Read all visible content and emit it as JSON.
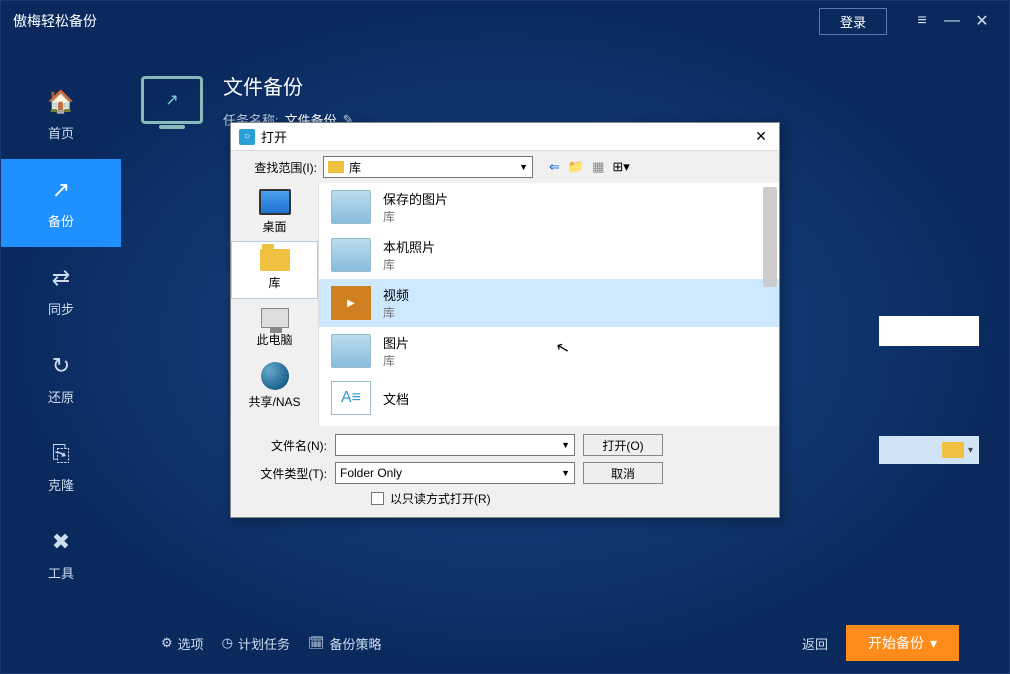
{
  "app": {
    "title": "傲梅轻松备份"
  },
  "titlebar": {
    "login": "登录"
  },
  "sidebar": {
    "items": [
      {
        "label": "首页"
      },
      {
        "label": "备份"
      },
      {
        "label": "同步"
      },
      {
        "label": "还原"
      },
      {
        "label": "克隆"
      },
      {
        "label": "工具"
      }
    ]
  },
  "page": {
    "title": "文件备份",
    "task_label": "任务名称:",
    "task_name": "文件备份"
  },
  "footer": {
    "options": "选项",
    "schedule": "计划任务",
    "scheme": "备份策略",
    "back": "返回",
    "start": "开始备份"
  },
  "dialog": {
    "title": "打开",
    "lookin_label": "查找范围(I):",
    "lookin_value": "库",
    "places": [
      {
        "label": "桌面"
      },
      {
        "label": "库"
      },
      {
        "label": "此电脑"
      },
      {
        "label": "共享/NAS"
      }
    ],
    "files": [
      {
        "name": "保存的图片",
        "sub": "库"
      },
      {
        "name": "本机照片",
        "sub": "库"
      },
      {
        "name": "视频",
        "sub": "库"
      },
      {
        "name": "图片",
        "sub": "库"
      },
      {
        "name": "文档",
        "sub": ""
      }
    ],
    "filename_label": "文件名(N):",
    "filename_value": "",
    "filetype_label": "文件类型(T):",
    "filetype_value": "Folder Only",
    "readonly_label": "以只读方式打开(R)",
    "open_btn": "打开(O)",
    "cancel_btn": "取消"
  }
}
